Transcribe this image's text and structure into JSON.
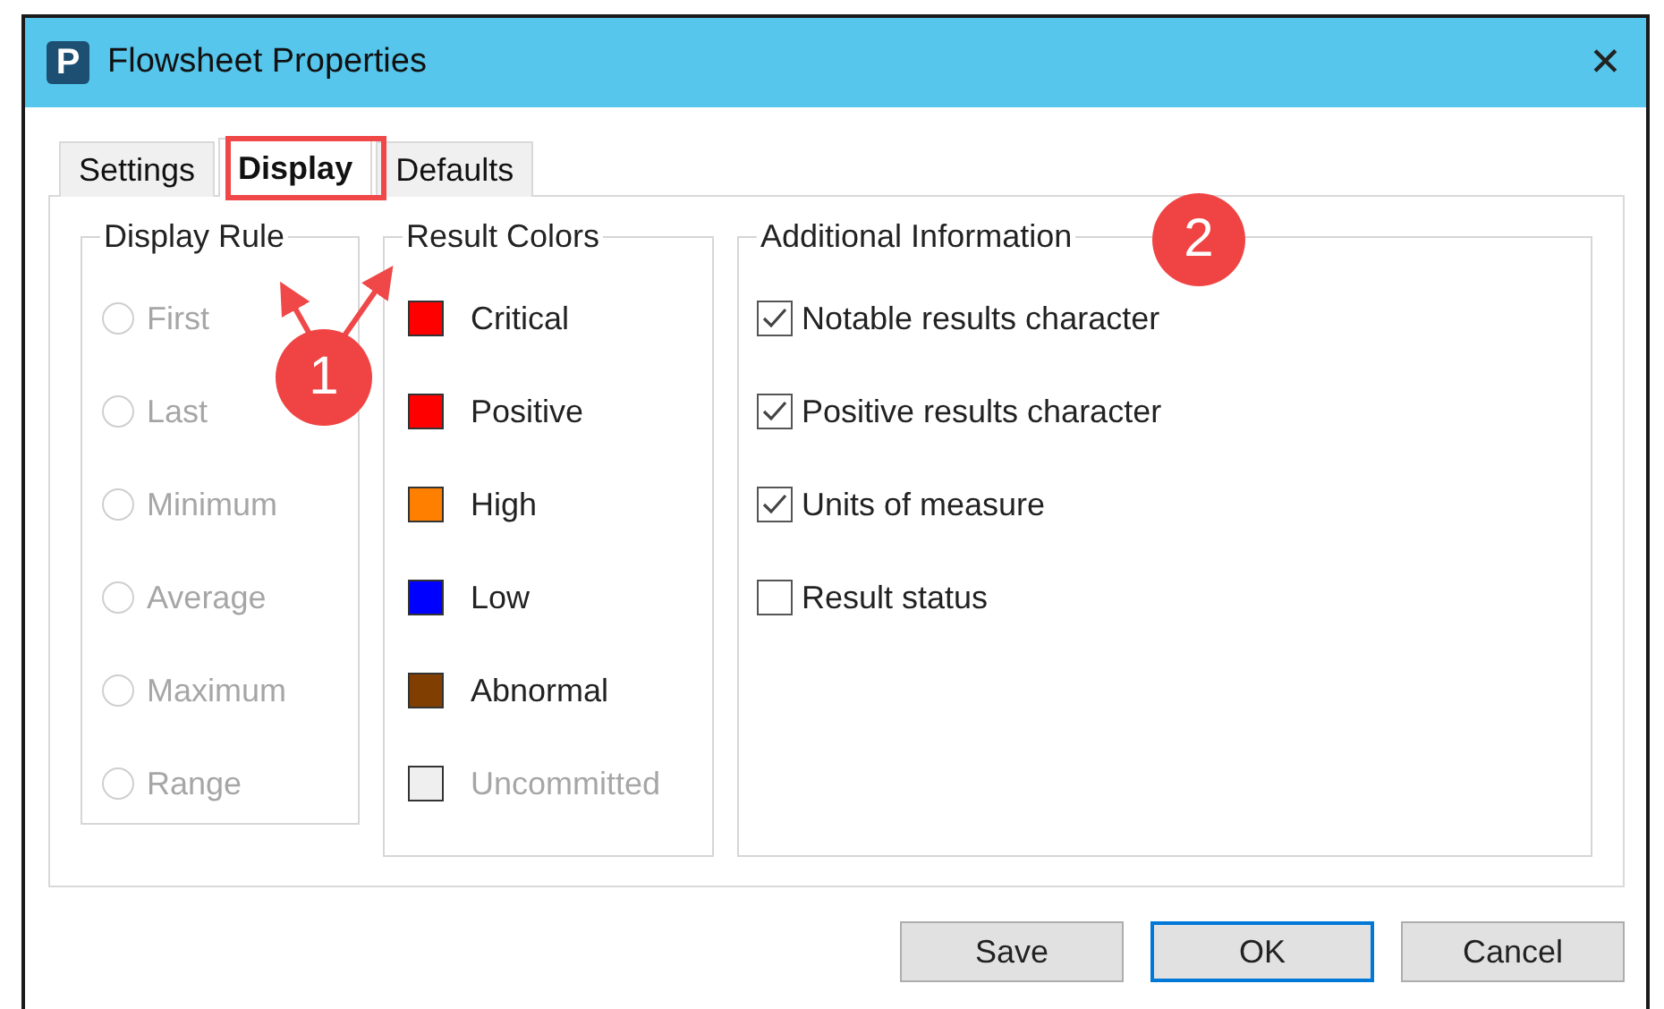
{
  "window": {
    "title": "Flowsheet Properties",
    "logo_text": "P",
    "close": "✕"
  },
  "tabs": [
    {
      "label": "Settings",
      "selected": false,
      "highlighted": false
    },
    {
      "label": "Display",
      "selected": true,
      "highlighted": true
    },
    {
      "label": "Defaults",
      "selected": false,
      "highlighted": false
    }
  ],
  "display_rule": {
    "title": "Display Rule",
    "options": [
      {
        "label": "First",
        "selected": false,
        "disabled": true
      },
      {
        "label": "Last",
        "selected": false,
        "disabled": true
      },
      {
        "label": "Minimum",
        "selected": false,
        "disabled": true
      },
      {
        "label": "Average",
        "selected": false,
        "disabled": true
      },
      {
        "label": "Maximum",
        "selected": false,
        "disabled": true
      },
      {
        "label": "Range",
        "selected": false,
        "disabled": true
      }
    ]
  },
  "result_colors": {
    "title": "Result Colors",
    "items": [
      {
        "label": "Critical",
        "color": "#ff0000",
        "disabled": false
      },
      {
        "label": "Positive",
        "color": "#ff0000",
        "disabled": false
      },
      {
        "label": "High",
        "color": "#ff8000",
        "disabled": false
      },
      {
        "label": "Low",
        "color": "#0000ff",
        "disabled": false
      },
      {
        "label": "Abnormal",
        "color": "#803f00",
        "disabled": false
      },
      {
        "label": "Uncommitted",
        "color": "#efefef",
        "disabled": true
      }
    ]
  },
  "additional_information": {
    "title": "Additional Information",
    "items": [
      {
        "label": "Notable results character",
        "checked": true
      },
      {
        "label": "Positive results character",
        "checked": true
      },
      {
        "label": "Units of measure",
        "checked": true
      },
      {
        "label": "Result status",
        "checked": false
      }
    ]
  },
  "buttons": [
    {
      "label": "Save",
      "default": false
    },
    {
      "label": "OK",
      "default": true
    },
    {
      "label": "Cancel",
      "default": false
    }
  ],
  "callouts": [
    {
      "label": "1"
    },
    {
      "label": "2"
    }
  ]
}
